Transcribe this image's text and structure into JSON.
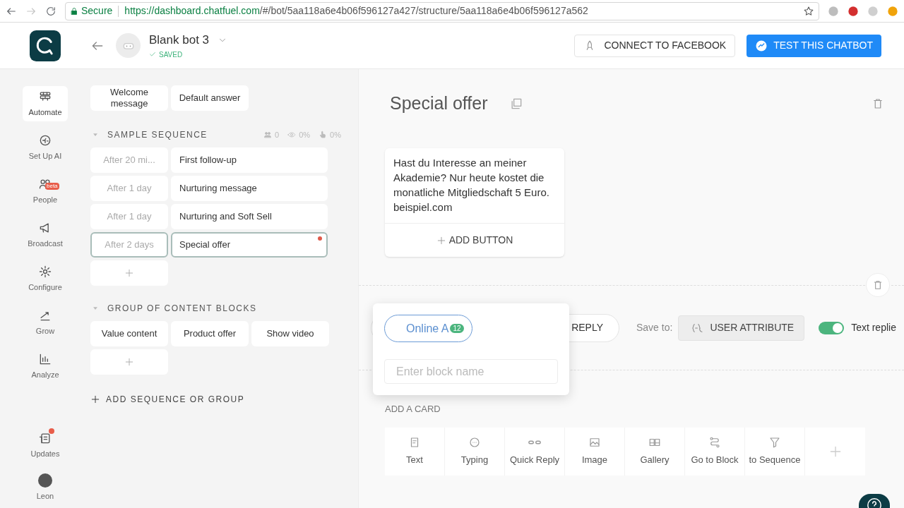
{
  "browser": {
    "secure_label": "Secure",
    "url_host": "https://dashboard.chatfuel.com",
    "url_path": "/#/bot/5aa118a6e4b06f596127a427/structure/5aa118a6e4b06f596127a562"
  },
  "header": {
    "bot_name": "Blank bot 3",
    "save_status": "SAVED",
    "connect_button": "CONNECT TO FACEBOOK",
    "test_button": "TEST THIS CHATBOT"
  },
  "nav": [
    {
      "label": "Automate",
      "selected": true,
      "notification": false
    },
    {
      "label": "Set Up AI",
      "selected": false,
      "notification": false
    },
    {
      "label": "People",
      "selected": false,
      "badge": "beta",
      "notification": false
    },
    {
      "label": "Broadcast",
      "selected": false,
      "notification": false
    },
    {
      "label": "Configure",
      "selected": false,
      "notification": false
    },
    {
      "label": "Grow",
      "selected": false,
      "notification": false
    },
    {
      "label": "Analyze",
      "selected": false,
      "notification": false
    }
  ],
  "nav_bottom": [
    {
      "label": "Updates",
      "selected": false,
      "notification": true
    },
    {
      "label": "Leon",
      "selected": false,
      "notification": false
    }
  ],
  "top_blocks": [
    "Welcome message",
    "Default answer"
  ],
  "sequence": {
    "title": "SAMPLE SEQUENCE",
    "stats": {
      "users": "0",
      "opened": "0%",
      "clicked": "0%"
    },
    "rows": [
      {
        "delay": "After 20 mi...",
        "block": "First follow-up",
        "selected": false,
        "dot": false
      },
      {
        "delay": "After 1 day",
        "block": "Nurturing message",
        "selected": false,
        "dot": false
      },
      {
        "delay": "After 1 day",
        "block": "Nurturing and Soft Sell",
        "selected": false,
        "dot": false
      },
      {
        "delay": "After 2 days",
        "block": "Special offer",
        "selected": true,
        "dot": true
      }
    ]
  },
  "group": {
    "title": "GROUP OF CONTENT BLOCKS",
    "blocks": [
      "Value content",
      "Product offer",
      "Show video"
    ]
  },
  "add_sequence": "ADD SEQUENCE OR GROUP",
  "editor": {
    "title": "Special offer",
    "text_card": {
      "text": "Hast du Interesse an meiner Akademie? Nur heute kostet die monatliche Mitgliedschaft 5 Euro. beispiel.com",
      "add_button": "ADD BUTTON"
    },
    "quick_reply": {
      "button": "REPLY",
      "save_to_label": "Save to:",
      "attribute_button": "USER ATTRIBUTE",
      "text_replies_label": "Text replie",
      "text_replies_on": true
    },
    "add_card_label": "ADD A CARD",
    "card_types": [
      "Text",
      "Typing",
      "Quick Reply",
      "Image",
      "Gallery",
      "Go to Block",
      "to Sequence"
    ]
  },
  "popup": {
    "chip": "Online A",
    "chip_count": "12",
    "input_placeholder": "Enter block name"
  }
}
